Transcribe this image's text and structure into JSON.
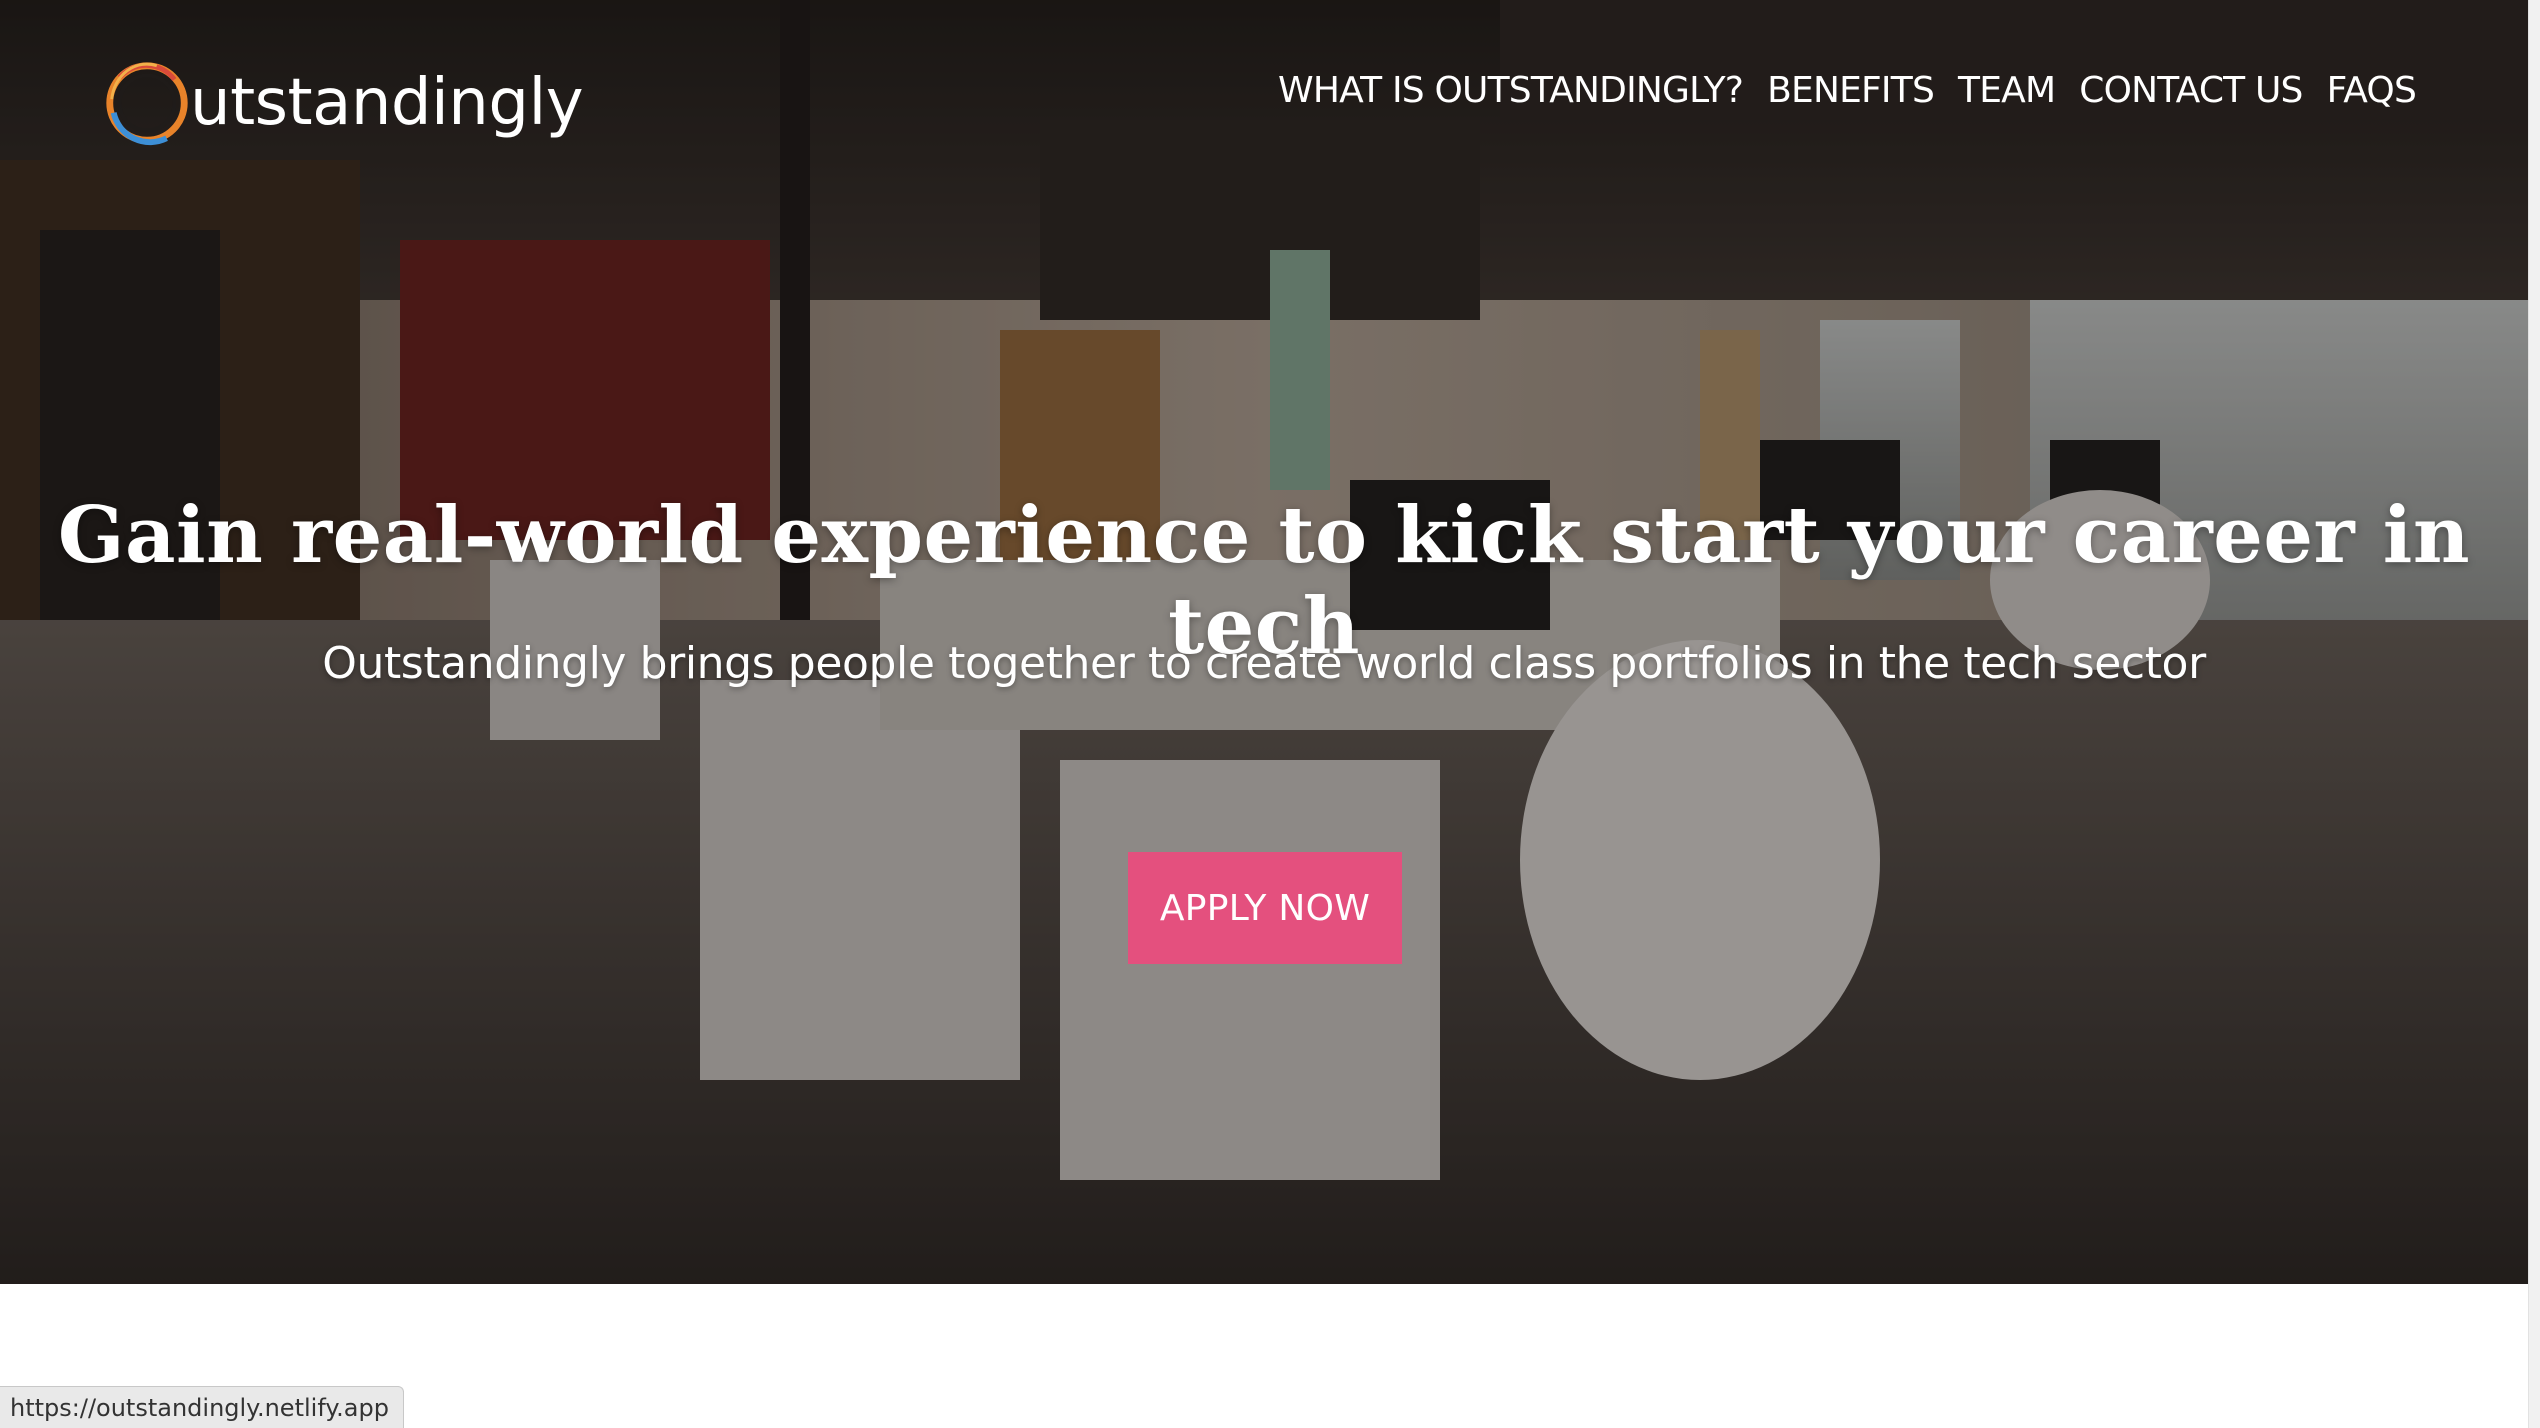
{
  "brand": {
    "logo_text": "utstandingly",
    "colors": {
      "ring_orange": "#e8832a",
      "ring_blue": "#3d8fd6",
      "ring_red": "#d94a3a",
      "accent": "#e4507e"
    }
  },
  "nav": {
    "items": [
      {
        "label": "WHAT IS OUTSTANDINGLY?"
      },
      {
        "label": "BENEFITS"
      },
      {
        "label": "TEAM"
      },
      {
        "label": "CONTACT US"
      },
      {
        "label": "FAQS"
      }
    ]
  },
  "hero": {
    "headline": "Gain real-world experience to kick start your career in tech",
    "subheadline": "Outstandingly brings people together to create world class portfolios in the tech sector",
    "cta_label": "APPLY NOW",
    "background": "office-photo"
  },
  "status_bar": {
    "url": "https://outstandingly.netlify.app"
  }
}
